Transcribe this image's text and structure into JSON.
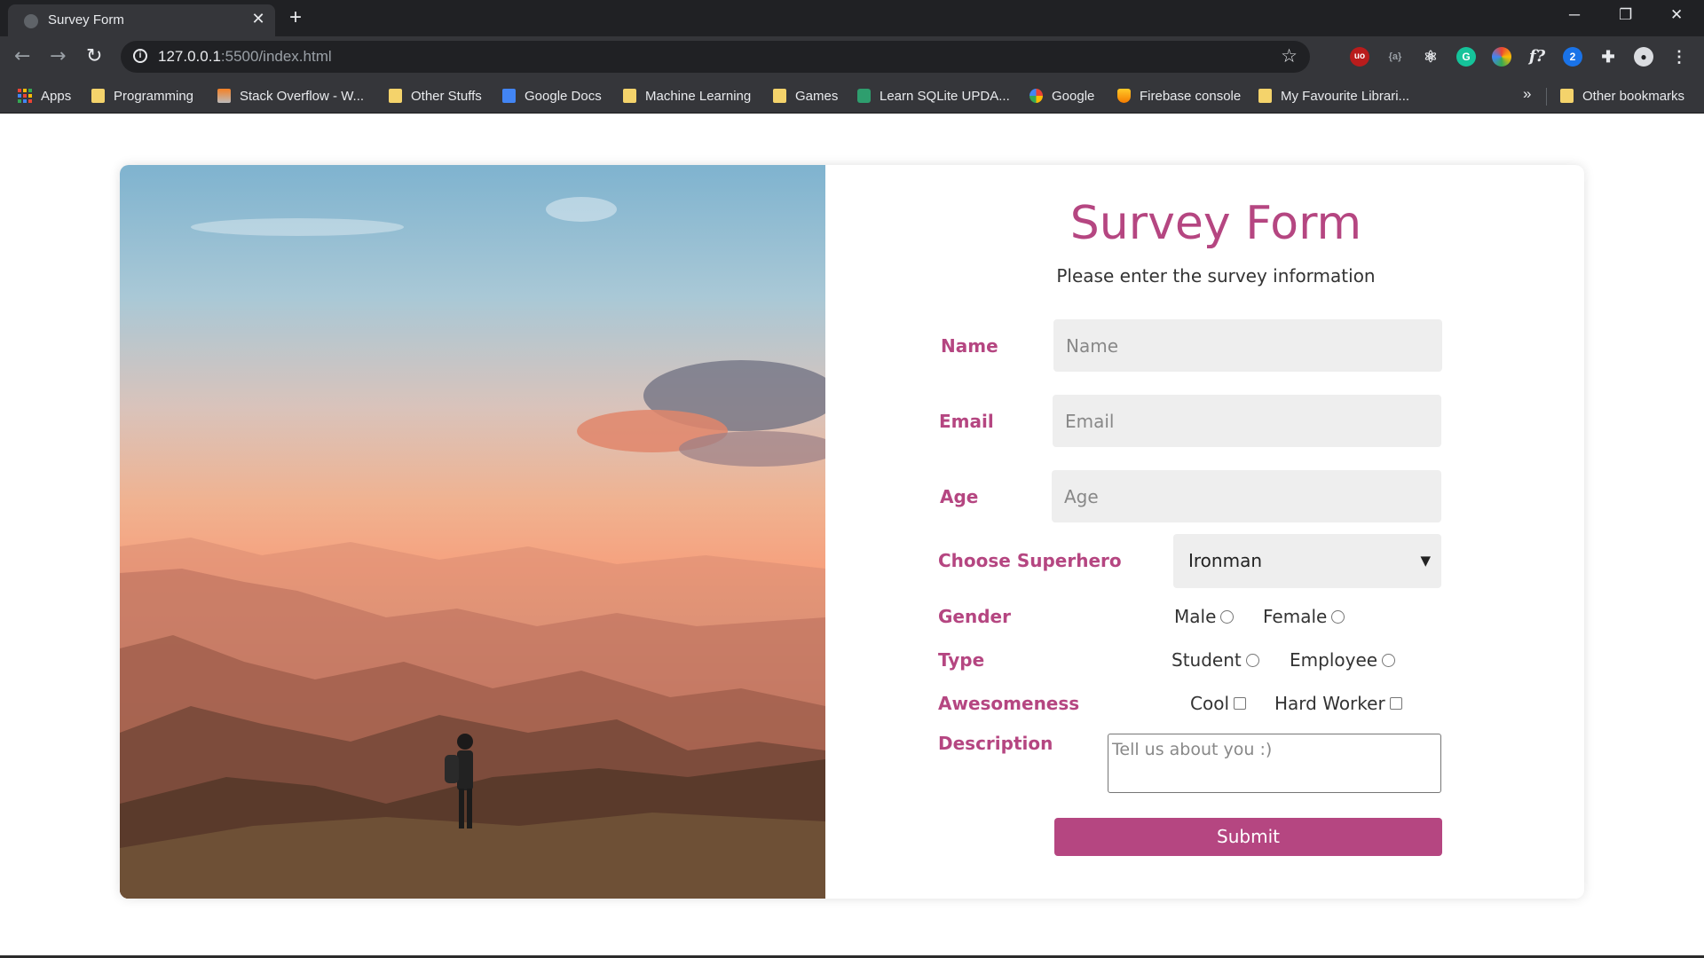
{
  "browser": {
    "tab_title": "Survey Form",
    "tab_close": "✕",
    "new_tab": "+",
    "window_controls": {
      "minimize": "─",
      "restore": "❐",
      "close": "✕"
    },
    "url_host": "127.0.0.1",
    "url_rest": ":5500/index.html",
    "bookmarks": [
      {
        "label": "Apps",
        "icon": "apps-grid"
      },
      {
        "label": "Programming",
        "icon": "folder-icon"
      },
      {
        "label": "Stack Overflow - W...",
        "icon": "stackoverflow-icon"
      },
      {
        "label": "Other Stuffs",
        "icon": "folder-icon"
      },
      {
        "label": "Google Docs",
        "icon": "docs-icon"
      },
      {
        "label": "Machine Learning",
        "icon": "folder-icon"
      },
      {
        "label": "Games",
        "icon": "folder-icon"
      },
      {
        "label": "Learn SQLite UPDA...",
        "icon": "sqlite-icon"
      },
      {
        "label": "Google",
        "icon": "google-icon"
      },
      {
        "label": "Firebase console",
        "icon": "firebase-icon"
      },
      {
        "label": "My Favourite Librari...",
        "icon": "folder-icon"
      }
    ],
    "more_bookmarks": "»",
    "other_bookmarks": "Other bookmarks"
  },
  "form": {
    "title": "Survey Form",
    "subtitle": "Please enter the survey information",
    "name_label": "Name",
    "name_placeholder": "Name",
    "email_label": "Email",
    "email_placeholder": "Email",
    "age_label": "Age",
    "age_placeholder": "Age",
    "superhero_label": "Choose Superhero",
    "superhero_value": "Ironman",
    "gender_label": "Gender",
    "gender_options": [
      "Male",
      "Female"
    ],
    "type_label": "Type",
    "type_options": [
      "Student",
      "Employee"
    ],
    "awesomeness_label": "Awesomeness",
    "awesomeness_options": [
      "Cool",
      "Hard Worker"
    ],
    "description_label": "Description",
    "description_placeholder": "Tell us about you :)",
    "submit_label": "Submit"
  },
  "colors": {
    "accent": "#b54681",
    "field_bg": "#eeeeee",
    "chrome_dark": "#202124",
    "chrome_mid": "#35363a"
  }
}
